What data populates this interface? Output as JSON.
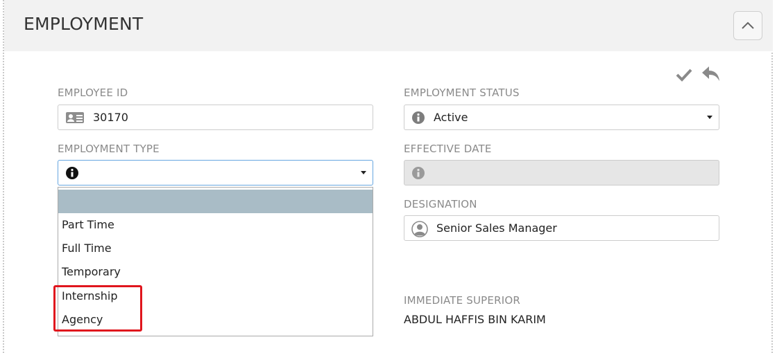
{
  "panel": {
    "title": "EMPLOYMENT"
  },
  "fields": {
    "employee_id": {
      "label": "EMPLOYEE ID",
      "value": "30170"
    },
    "employment_status": {
      "label": "EMPLOYMENT STATUS",
      "value": "Active"
    },
    "employment_type": {
      "label": "EMPLOYMENT TYPE",
      "value": ""
    },
    "effective_date": {
      "label": "EFFECTIVE DATE",
      "value": ""
    },
    "designation": {
      "label": "DESIGNATION",
      "value": "Senior Sales Manager"
    },
    "immediate_superior": {
      "label": "IMMEDIATE SUPERIOR",
      "value": "ABDUL HAFFIS BIN KARIM"
    }
  },
  "dropdown": {
    "options": [
      "",
      "Part Time",
      "Full Time",
      "Temporary",
      "Internship",
      "Agency"
    ]
  },
  "colors": {
    "highlight_outline": "#e0151d",
    "option_hover": "#a9bcc6",
    "focus_border": "#66a6e0"
  }
}
